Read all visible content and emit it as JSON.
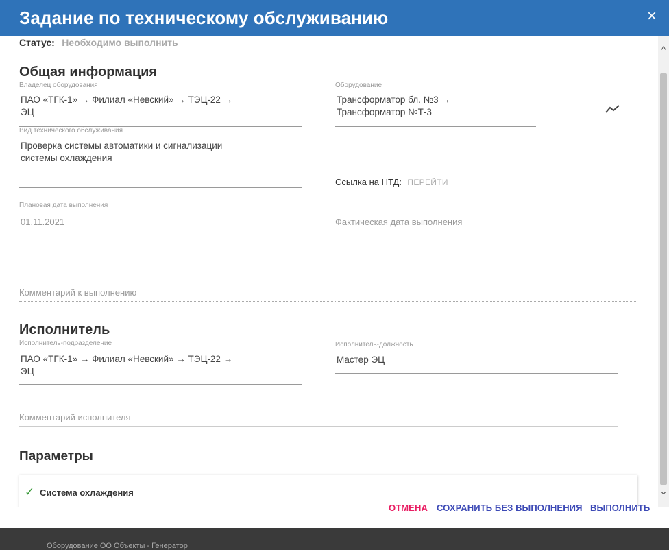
{
  "dialog": {
    "title": "Задание по техническому обслуживанию",
    "close_icon": "×"
  },
  "status": {
    "label": "Статус:",
    "value": "Необходимо выполнить"
  },
  "general": {
    "heading": "Общая информация",
    "owner_label": "Владелец оборудования",
    "owner_value_line1": "ПАО «ТГК-1» → Филиал «Невский» → ТЭЦ-22 →",
    "owner_value_line2": "ЭЦ",
    "equipment_label": "Оборудование",
    "equipment_value_line1": "Трансформатор бл. №3 →",
    "equipment_value_line2": "Трансформатор №Т-3",
    "maintenance_type_label": "Вид технического обслуживания",
    "maintenance_type_line1": "Проверка системы автоматики и сигнализации",
    "maintenance_type_line2": "системы охлаждения",
    "ntd_label": "Ссылка на НТД:",
    "ntd_link": "ПЕРЕЙТИ",
    "planned_date_label": "Плановая дата выполнения",
    "planned_date_value": "01.11.2021",
    "actual_date_placeholder": "Фактическая дата выполнения",
    "comment_placeholder": "Комментарий к выполнению"
  },
  "executor": {
    "heading": "Исполнитель",
    "division_label": "Исполнитель-подразделение",
    "division_line1": "ПАО «ТГК-1» → Филиал «Невский» → ТЭЦ-22 →",
    "division_line2": "ЭЦ",
    "position_label": "Исполнитель-должность",
    "position_value": "Мастер ЭЦ",
    "comment_placeholder": "Комментарий исполнителя"
  },
  "parameters": {
    "heading": "Параметры",
    "items": [
      {
        "label": "Система охлаждения",
        "checked": true
      }
    ]
  },
  "actions": {
    "cancel": "ОТМЕНА",
    "save_without": "СОХРАНИТЬ БЕЗ ВЫПОЛНЕНИЯ",
    "execute": "ВЫПОЛНИТЬ"
  },
  "background": {
    "text": "Оборудование ОО Объекты - Генератор"
  },
  "colors": {
    "header": "#2f73b9",
    "cancel": "#e91e63",
    "primary": "#3d4ab6",
    "check": "#3a9a3a"
  }
}
